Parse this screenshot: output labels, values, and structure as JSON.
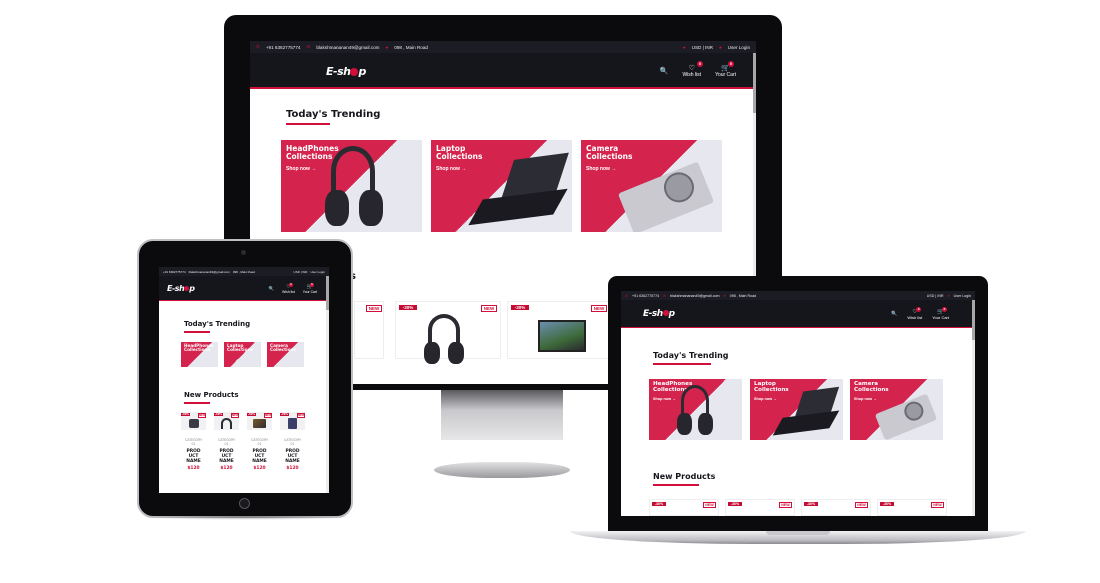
{
  "topbar": {
    "phone": "+91 6362775774",
    "email": "blakshmananan49@gmail.com",
    "address": "098 , Main Road",
    "currency": "USD | INR",
    "login": "User Login",
    "phone_icon": "phone-icon",
    "email_icon": "envelope-icon",
    "address_icon": "map-pin-icon",
    "currency_icon": "currency-icon",
    "user_icon": "user-icon"
  },
  "navbar": {
    "logo_prefix": "E-sh",
    "logo_o": "o",
    "logo_suffix": "p",
    "search_icon": "search-icon",
    "wishlist_label": "Wish list",
    "wishlist_count": "0",
    "cart_label": "Your Cart",
    "cart_count": "0"
  },
  "trending": {
    "title": "Today's Trending",
    "cards": [
      {
        "title_line1": "HeadPhones",
        "title_line2": "Collections",
        "shop": "Shop now →",
        "image": "headphones"
      },
      {
        "title_line1": "Laptop",
        "title_line2": "Collections",
        "shop": "Shop now →",
        "image": "laptop"
      },
      {
        "title_line1": "Camera",
        "title_line2": "Collections",
        "shop": "Shop now →",
        "image": "camera"
      }
    ]
  },
  "new_products": {
    "title": "New Products",
    "new_tag": "NEW",
    "discount_tag": "-30%",
    "tablet_products": [
      {
        "category": "CATEGORY",
        "category2": "01",
        "name1": "PROD",
        "name2": "UCT",
        "name3": "NAME",
        "price": "$120"
      },
      {
        "category": "CATEGORY",
        "category2": "01",
        "name1": "PROD",
        "name2": "UCT",
        "name3": "NAME",
        "price": "$120"
      },
      {
        "category": "CATEGORY",
        "category2": "01",
        "name1": "PROD",
        "name2": "UCT",
        "name3": "NAME",
        "price": "$120"
      },
      {
        "category": "CATEGORY",
        "category2": "01",
        "name1": "PROD",
        "name2": "UCT",
        "name3": "NAME",
        "price": "$120"
      }
    ]
  },
  "colors": {
    "accent": "#d0103a",
    "dark": "#15151c",
    "card_bg": "#e7e8ef"
  }
}
